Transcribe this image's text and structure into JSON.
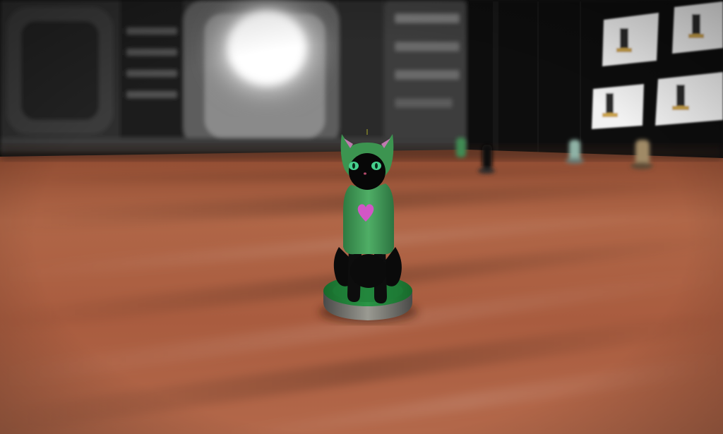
{
  "scene": {
    "colors": {
      "floor_light": "#b3684a",
      "floor_dark": "#6e3521",
      "wall_dark": "#141414",
      "wall_grey": "#5a5a5a",
      "lamp_glow": "#ffffff",
      "figurine_green": "#3f9a55",
      "figurine_black": "#0a0a0a",
      "heart_pink": "#d256c6",
      "base_green": "#1f7a35",
      "eye_green": "#46d08e"
    },
    "icons": {
      "main_figurine": "cat-figurine-icon",
      "background_figurines": "figurine-silhouette-icon",
      "wall_posters": "poster-screen-icon",
      "ceiling_lamp": "light-glow-icon"
    }
  }
}
